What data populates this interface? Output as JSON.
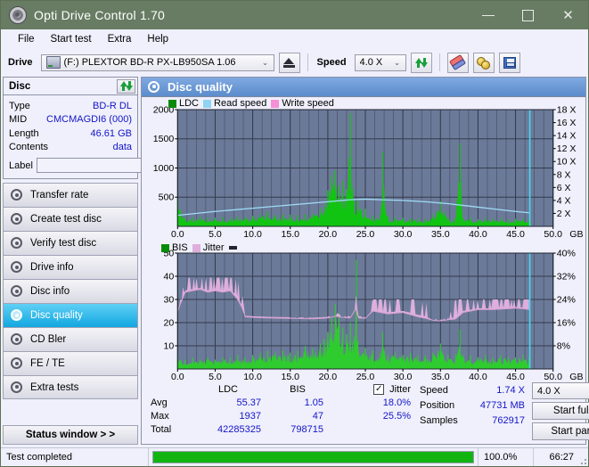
{
  "window": {
    "title": "Opti Drive Control 1.70",
    "icon": "disc-icon",
    "controls": {
      "minimize": "–",
      "maximize": "□",
      "close": "✕"
    }
  },
  "menu": {
    "items": [
      "File",
      "Start test",
      "Extra",
      "Help"
    ]
  },
  "toolbar": {
    "drive_label": "Drive",
    "drive_value": "(F:)  PLEXTOR BD-R  PX-LB950SA 1.06",
    "eject_icon": "eject-icon",
    "speed_label": "Speed",
    "speed_value": "4.0 X",
    "refresh_icon": "refresh-icon",
    "eraser_icon": "eraser-icon",
    "gold_icon": "binoculars-icon",
    "save_icon": "save-icon"
  },
  "disc_panel": {
    "title": "Disc",
    "refresh_icon": "refresh-icon",
    "rows": [
      {
        "key": "Type",
        "value": "BD-R DL"
      },
      {
        "key": "MID",
        "value": "CMCMAGDI6 (000)"
      },
      {
        "key": "Length",
        "value": "46.61 GB"
      },
      {
        "key": "Contents",
        "value": "data"
      }
    ],
    "label_key": "Label",
    "label_value": "",
    "label_placeholder": "",
    "disc_button_icon": "disc-icon"
  },
  "sidebar": {
    "items": [
      {
        "label": "Transfer rate",
        "icon": "disc-icon",
        "active": false
      },
      {
        "label": "Create test disc",
        "icon": "disc-icon",
        "active": false
      },
      {
        "label": "Verify test disc",
        "icon": "disc-icon",
        "active": false
      },
      {
        "label": "Drive info",
        "icon": "disc-icon",
        "active": false
      },
      {
        "label": "Disc info",
        "icon": "disc-icon",
        "active": false
      },
      {
        "label": "Disc quality",
        "icon": "disc-icon",
        "active": true
      },
      {
        "label": "CD Bler",
        "icon": "disc-icon",
        "active": false
      },
      {
        "label": "FE / TE",
        "icon": "disc-icon",
        "active": false
      },
      {
        "label": "Extra tests",
        "icon": "disc-icon",
        "active": false
      }
    ],
    "status_window_label": "Status window > >"
  },
  "main": {
    "title": "Disc quality",
    "icon": "disc-icon"
  },
  "stats": {
    "columns": [
      "",
      "LDC",
      "BIS"
    ],
    "jitter_label": "Jitter",
    "jitter_checked": true,
    "rows": [
      {
        "label": "Avg",
        "ldc": "55.37",
        "bis": "1.05",
        "jitter": "18.0%"
      },
      {
        "label": "Max",
        "ldc": "1937",
        "bis": "47",
        "jitter": "25.5%"
      },
      {
        "label": "Total",
        "ldc": "42285325",
        "bis": "798715",
        "jitter": ""
      }
    ]
  },
  "run_info": {
    "speed_key": "Speed",
    "speed_value": "1.74 X",
    "position_key": "Position",
    "position_value": "47731 MB",
    "samples_key": "Samples",
    "samples_value": "762917",
    "speed_select": "4.0 X",
    "start_full_label": "Start full",
    "start_part_label": "Start part"
  },
  "statusbar": {
    "message": "Test completed",
    "progress_percent": 100,
    "progress_text": "100.0%",
    "elapsed": "66:27"
  },
  "colors": {
    "title_bar": "#677c63",
    "plot_bg": "#6b7a99",
    "grid": "#3b4358",
    "ldc_green": "#12c412",
    "read_speed": "#9fdcf7",
    "write_speed": "#f58fd6",
    "jitter_pink": "#deaedd",
    "bis_green": "#2ecc2e",
    "accent_blue": "#1414c8",
    "progress_green": "#12b412",
    "marker_cyan": "#48d8f0"
  },
  "chart_data": [
    {
      "type": "line",
      "id": "ldc-chart",
      "title": "",
      "legend": [
        {
          "name": "LDC",
          "color": "#0a8a0a"
        },
        {
          "name": "Read speed",
          "color": "#8fd4f2"
        },
        {
          "name": "Write speed",
          "color": "#f58fd6"
        }
      ],
      "legend_position": "top-left",
      "grid": true,
      "xlabel": "GB",
      "x": [
        0.0,
        5.0,
        10.0,
        15.0,
        20.0,
        25.0,
        30.0,
        35.0,
        40.0,
        45.0,
        50.0
      ],
      "xlim": [
        0,
        50
      ],
      "ylabel": "",
      "ylim": [
        0,
        2000
      ],
      "yticks": [
        500,
        1000,
        1500,
        2000
      ],
      "y2label": "",
      "y2lim": [
        0,
        18
      ],
      "y2ticks": [
        "2 X",
        "4 X",
        "6 X",
        "8 X",
        "10 X",
        "12 X",
        "14 X",
        "16 X",
        "18 X"
      ],
      "series": [
        {
          "name": "LDC",
          "color": "#12c412",
          "style": "filled-spikes",
          "x": [
            0.0,
            1.0,
            2.0,
            3.0,
            4.0,
            5.0,
            6.0,
            7.0,
            8.0,
            9.0,
            10.0,
            11.0,
            12.0,
            13.0,
            14.0,
            15.0,
            16.0,
            17.0,
            18.0,
            19.0,
            20.0,
            20.5,
            21.0,
            21.5,
            22.0,
            22.5,
            23.0,
            23.5,
            24.0,
            25.0,
            26.0,
            27.0,
            27.3,
            28.0,
            29.0,
            30.0,
            31.0,
            32.0,
            33.0,
            34.0,
            35.0,
            36.0,
            37.0,
            37.6,
            38.0,
            39.0,
            40.0,
            41.0,
            42.0,
            43.0,
            44.0,
            45.0,
            46.0,
            46.8
          ],
          "values": [
            470,
            150,
            160,
            170,
            150,
            150,
            160,
            150,
            170,
            160,
            180,
            200,
            260,
            200,
            210,
            200,
            200,
            210,
            220,
            320,
            620,
            880,
            960,
            700,
            780,
            640,
            1937,
            430,
            460,
            300,
            180,
            200,
            1280,
            170,
            160,
            150,
            140,
            130,
            130,
            200,
            430,
            160,
            140,
            1420,
            140,
            150,
            120,
            150,
            130,
            140,
            120,
            130,
            140,
            110
          ]
        },
        {
          "name": "Read speed",
          "color": "#9fdcf7",
          "style": "line",
          "axis": "y2",
          "x": [
            0.0,
            5.0,
            10.0,
            15.0,
            20.0,
            23.0,
            25.0,
            27.0,
            30.0,
            33.0,
            36.0,
            39.0,
            42.0,
            45.0,
            46.8
          ],
          "values": [
            1.7,
            2.3,
            2.8,
            3.3,
            3.8,
            4.1,
            4.2,
            4.1,
            4.0,
            3.8,
            3.5,
            3.1,
            2.7,
            2.3,
            2.1
          ]
        },
        {
          "name": "end-marker",
          "color": "#48d8f0",
          "style": "vline",
          "x": [
            46.9
          ]
        }
      ]
    },
    {
      "type": "line",
      "id": "bis-jitter-chart",
      "title": "",
      "legend": [
        {
          "name": "BIS",
          "color": "#0a8a0a"
        },
        {
          "name": "Jitter",
          "color": "#deaedd"
        },
        {
          "name": "marker",
          "color": "#23232e"
        }
      ],
      "legend_position": "top-left",
      "grid": true,
      "xlabel": "GB",
      "x": [
        0.0,
        5.0,
        10.0,
        15.0,
        20.0,
        25.0,
        30.0,
        35.0,
        40.0,
        45.0,
        50.0
      ],
      "xlim": [
        0,
        50
      ],
      "ylim": [
        0,
        50
      ],
      "yticks": [
        10,
        20,
        30,
        40,
        50
      ],
      "y2lim": [
        0,
        40
      ],
      "y2ticks": [
        "8%",
        "16%",
        "24%",
        "32%",
        "40%"
      ],
      "series": [
        {
          "name": "BIS",
          "color": "#2ecc2e",
          "style": "filled-spikes",
          "x": [
            0.0,
            1.0,
            2.0,
            3.0,
            4.0,
            5.0,
            6.0,
            7.0,
            8.0,
            9.0,
            10.0,
            11.0,
            12.0,
            13.0,
            14.0,
            15.0,
            16.0,
            17.0,
            18.0,
            19.0,
            19.5,
            20.0,
            20.5,
            21.0,
            21.5,
            22.0,
            22.5,
            23.0,
            23.5,
            23.8,
            24.0,
            25.0,
            26.0,
            27.0,
            27.3,
            28.0,
            29.0,
            30.0,
            31.0,
            32.0,
            33.0,
            34.0,
            35.0,
            36.0,
            37.0,
            37.6,
            38.0,
            39.0,
            40.0,
            41.0,
            42.0,
            43.0,
            44.0,
            45.0,
            46.0,
            46.8
          ],
          "values": [
            5,
            4,
            5,
            4,
            5,
            4,
            5,
            5,
            6,
            5,
            6,
            7,
            8,
            7,
            8,
            7,
            8,
            10,
            9,
            11,
            13,
            16,
            22,
            28,
            24,
            18,
            15,
            20,
            14,
            47,
            12,
            9,
            8,
            7,
            16,
            6,
            7,
            6,
            7,
            6,
            6,
            7,
            11,
            6,
            6,
            17,
            6,
            6,
            5,
            6,
            5,
            6,
            5,
            5,
            6,
            5
          ]
        },
        {
          "name": "Jitter",
          "color": "#deaedd",
          "style": "band",
          "axis": "y2",
          "x": [
            0.0,
            1.0,
            2.0,
            3.0,
            4.0,
            5.0,
            6.0,
            7.0,
            8.0,
            8.6,
            9.0,
            10.0,
            12.0,
            14.0,
            16.0,
            18.0,
            20.0,
            21.0,
            22.0,
            23.0,
            23.8,
            24.0,
            25.0,
            26.0,
            28.0,
            30.0,
            32.0,
            33.0,
            34.0,
            35.0,
            36.0,
            37.0,
            38.0,
            39.0,
            40.0,
            42.0,
            44.0,
            45.0,
            46.0,
            46.8
          ],
          "values": [
            20.0,
            26.5,
            27.0,
            27.5,
            26.5,
            27.0,
            26.5,
            27.0,
            24.0,
            21.0,
            18.0,
            17.8,
            17.6,
            17.5,
            17.4,
            17.3,
            17.6,
            18.2,
            17.8,
            17.6,
            21.0,
            17.6,
            17.5,
            20.0,
            19.0,
            19.5,
            18.0,
            17.5,
            16.8,
            16.6,
            17.0,
            17.2,
            19.5,
            20.0,
            20.5,
            20.5,
            20.8,
            21.0,
            20.8,
            20.5
          ],
          "high": [
            20.0,
            31.5,
            31.5,
            31.5,
            31.5,
            31.5,
            31.5,
            31.5,
            31.0,
            26.0,
            18.4,
            18.2,
            18.0,
            17.9,
            17.8,
            17.7,
            18.0,
            19.5,
            18.4,
            18.2,
            26.0,
            18.2,
            18.0,
            24.0,
            24.0,
            24.0,
            24.0,
            23.5,
            17.4,
            17.2,
            17.6,
            24.0,
            24.0,
            24.0,
            24.0,
            24.0,
            24.0,
            24.0,
            24.0,
            24.0
          ]
        },
        {
          "name": "end-marker",
          "color": "#48d8f0",
          "style": "vline",
          "x": [
            46.9
          ]
        }
      ]
    }
  ]
}
